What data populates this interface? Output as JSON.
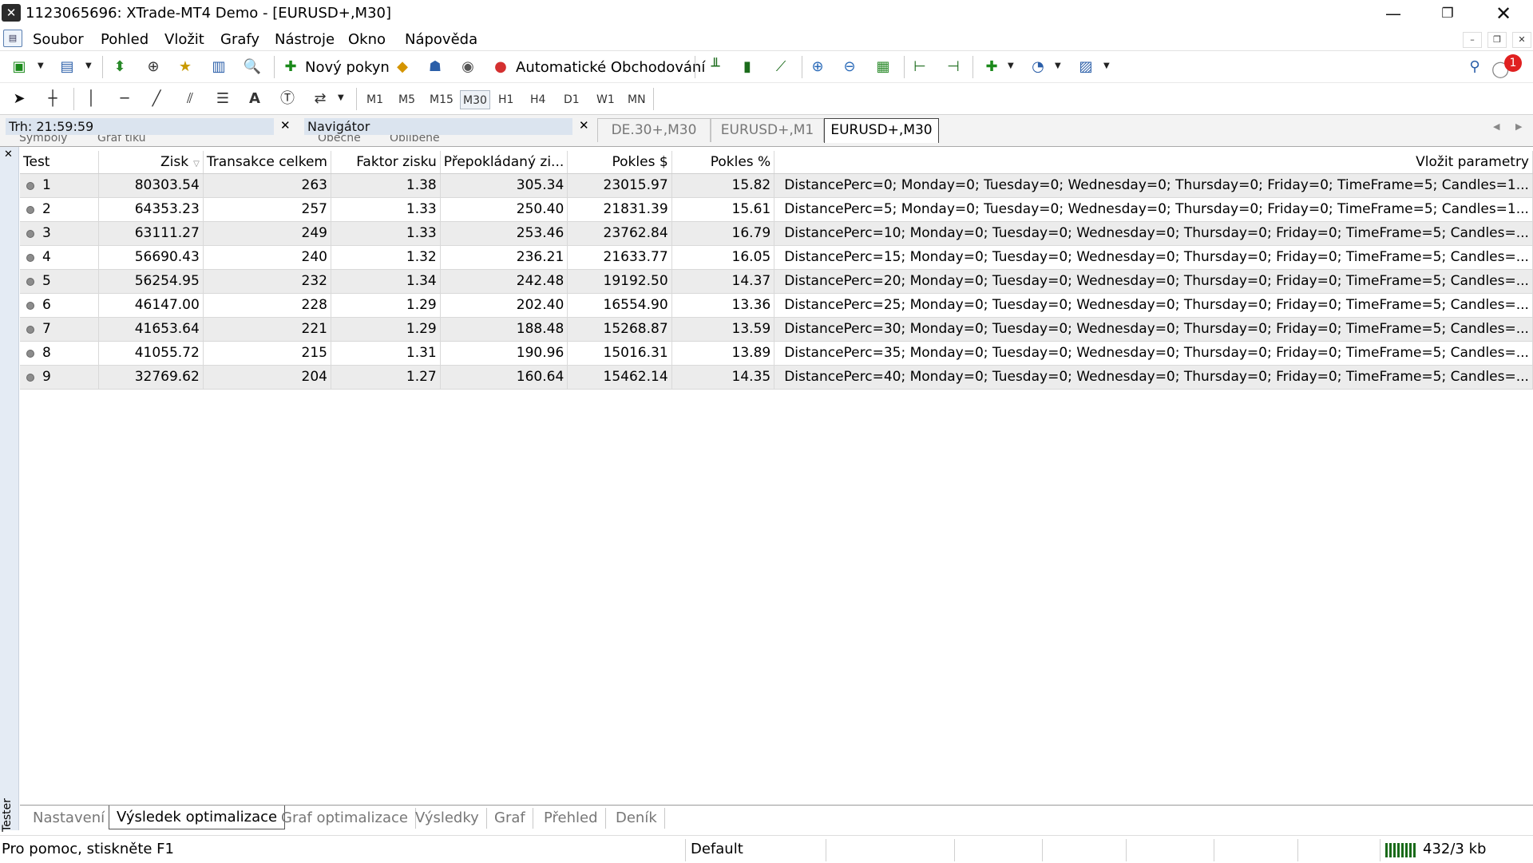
{
  "window": {
    "title": "1123065696: XTrade-MT4 Demo - [EURUSD+,M30]",
    "controls": [
      "minimize-icon",
      "restore-icon",
      "close-icon"
    ]
  },
  "menu": [
    "Soubor",
    "Pohled",
    "Vložit",
    "Grafy",
    "Nástroje",
    "Okno",
    "Nápověda"
  ],
  "toolbar": {
    "new_order": "Nový pokyn",
    "auto_trading": "Automatické Obchodování",
    "notification_count": "1"
  },
  "timeframes": [
    "M1",
    "M5",
    "M15",
    "M30",
    "H1",
    "H4",
    "D1",
    "W1",
    "MN"
  ],
  "active_timeframe": "M30",
  "panels": {
    "market": "Trh: 21:59:59",
    "navigator": "Navigátor",
    "market_tabs": [
      "Symboly",
      "Graf tiku"
    ],
    "navigator_tabs": [
      "Obecné",
      "Oblíbené"
    ]
  },
  "chart_tabs": [
    "DE.30+,M30",
    "EURUSD+,M1",
    "EURUSD+,M30"
  ],
  "tester": {
    "side_label": "Tester",
    "columns": [
      "Test",
      "Zisk",
      "Transakce celkem",
      "Faktor zisku",
      "Přepokládaný zi...",
      "Pokles $",
      "Pokles %",
      "Vložit parametry"
    ],
    "rows": [
      {
        "test": "1",
        "zisk": "80303.54",
        "transakce": "263",
        "faktor": "1.38",
        "prep": "305.34",
        "pokles_usd": "23015.97",
        "pokles_pct": "15.82",
        "params": "DistancePerc=0; Monday=0; Tuesday=0; Wednesday=0; Thursday=0; Friday=0; TimeFrame=5; Candles=1..."
      },
      {
        "test": "2",
        "zisk": "64353.23",
        "transakce": "257",
        "faktor": "1.33",
        "prep": "250.40",
        "pokles_usd": "21831.39",
        "pokles_pct": "15.61",
        "params": "DistancePerc=5; Monday=0; Tuesday=0; Wednesday=0; Thursday=0; Friday=0; TimeFrame=5; Candles=1..."
      },
      {
        "test": "3",
        "zisk": "63111.27",
        "transakce": "249",
        "faktor": "1.33",
        "prep": "253.46",
        "pokles_usd": "23762.84",
        "pokles_pct": "16.79",
        "params": "DistancePerc=10; Monday=0; Tuesday=0; Wednesday=0; Thursday=0; Friday=0; TimeFrame=5; Candles=..."
      },
      {
        "test": "4",
        "zisk": "56690.43",
        "transakce": "240",
        "faktor": "1.32",
        "prep": "236.21",
        "pokles_usd": "21633.77",
        "pokles_pct": "16.05",
        "params": "DistancePerc=15; Monday=0; Tuesday=0; Wednesday=0; Thursday=0; Friday=0; TimeFrame=5; Candles=..."
      },
      {
        "test": "5",
        "zisk": "56254.95",
        "transakce": "232",
        "faktor": "1.34",
        "prep": "242.48",
        "pokles_usd": "19192.50",
        "pokles_pct": "14.37",
        "params": "DistancePerc=20; Monday=0; Tuesday=0; Wednesday=0; Thursday=0; Friday=0; TimeFrame=5; Candles=..."
      },
      {
        "test": "6",
        "zisk": "46147.00",
        "transakce": "228",
        "faktor": "1.29",
        "prep": "202.40",
        "pokles_usd": "16554.90",
        "pokles_pct": "13.36",
        "params": "DistancePerc=25; Monday=0; Tuesday=0; Wednesday=0; Thursday=0; Friday=0; TimeFrame=5; Candles=..."
      },
      {
        "test": "7",
        "zisk": "41653.64",
        "transakce": "221",
        "faktor": "1.29",
        "prep": "188.48",
        "pokles_usd": "15268.87",
        "pokles_pct": "13.59",
        "params": "DistancePerc=30; Monday=0; Tuesday=0; Wednesday=0; Thursday=0; Friday=0; TimeFrame=5; Candles=..."
      },
      {
        "test": "8",
        "zisk": "41055.72",
        "transakce": "215",
        "faktor": "1.31",
        "prep": "190.96",
        "pokles_usd": "15016.31",
        "pokles_pct": "13.89",
        "params": "DistancePerc=35; Monday=0; Tuesday=0; Wednesday=0; Thursday=0; Friday=0; TimeFrame=5; Candles=..."
      },
      {
        "test": "9",
        "zisk": "32769.62",
        "transakce": "204",
        "faktor": "1.27",
        "prep": "160.64",
        "pokles_usd": "15462.14",
        "pokles_pct": "14.35",
        "params": "DistancePerc=40; Monday=0; Tuesday=0; Wednesday=0; Thursday=0; Friday=0; TimeFrame=5; Candles=..."
      }
    ],
    "tabs": [
      "Nastavení",
      "Výsledek optimalizace",
      "Graf optimalizace",
      "Výsledky",
      "Graf",
      "Přehled",
      "Deník"
    ],
    "active_tab": "Výsledek optimalizace"
  },
  "status": {
    "help": "Pro pomoc, stiskněte F1",
    "profile": "Default",
    "traffic": "432/3 kb"
  },
  "colors": {
    "panel_header": "#dbe4ef",
    "row_alt": "#ececec",
    "notification": "#e02020"
  }
}
